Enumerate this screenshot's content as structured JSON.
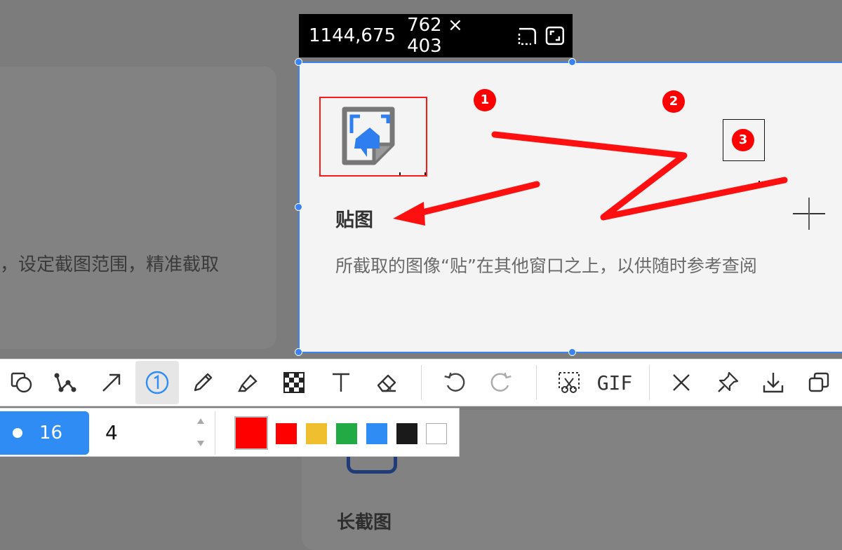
{
  "background": {
    "left_card_text": "，设定截图范围，精准截取",
    "bottom_card_title": "长截图"
  },
  "info_bar": {
    "position": "1144,675",
    "size": "762 × 403",
    "icons": [
      "dashed-corner-icon",
      "fullscreen-icon"
    ]
  },
  "card": {
    "title": "贴图",
    "description": "所截取的图像“贴”在其他窗口之上，以供随时参考查阅"
  },
  "annotations": {
    "badges": [
      "1",
      "2",
      "3"
    ],
    "color": "#ff0000"
  },
  "toolbar": {
    "tools": [
      "shape-icon",
      "polyline-icon",
      "arrow-icon",
      "number-marker-icon",
      "pencil-icon",
      "highlighter-icon",
      "mosaic-icon",
      "text-icon",
      "eraser-icon",
      "undo-icon",
      "redo-icon",
      "scissors-icon",
      "gif-button",
      "close-icon",
      "pin-icon",
      "download-icon",
      "copy-icon"
    ],
    "active_tool": "number-marker-icon",
    "gif_label": "GIF"
  },
  "subbar": {
    "size_label": "16",
    "step_value": "4",
    "selected_color": "#ff0000",
    "colors": [
      "#ff0000",
      "#f0bf30",
      "#22aa44",
      "#2f8cf5",
      "#1a1a1a",
      "#ffffff"
    ]
  },
  "accent_color": "#3b82f6"
}
